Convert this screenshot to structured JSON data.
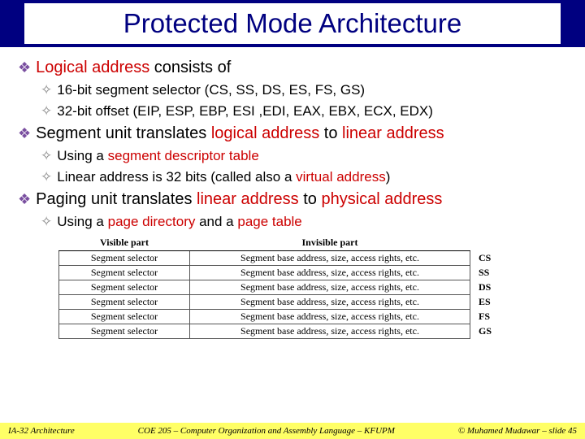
{
  "title": "Protected Mode Architecture",
  "bullets": {
    "b1_pre": "Logical address",
    "b1_post": " consists of",
    "b1a": "16-bit segment selector (CS, SS, DS, ES, FS, GS)",
    "b1b": "32-bit offset (EIP, ESP, EBP, ESI ,EDI, EAX, EBX, ECX, EDX)",
    "b2_pre": "Segment unit translates ",
    "b2_mid1": "logical address",
    "b2_mid2": " to ",
    "b2_end": "linear address",
    "b2a_pre": "Using a ",
    "b2a_red": "segment descriptor table",
    "b2b_pre": "Linear address is 32 bits (called also a ",
    "b2b_red": "virtual address",
    "b2b_post": ")",
    "b3_pre": "Paging unit translates ",
    "b3_mid1": "linear address",
    "b3_mid2": " to ",
    "b3_end": "physical address",
    "b3a_pre": "Using a ",
    "b3a_r1": "page directory",
    "b3a_mid": " and a ",
    "b3a_r2": "page table"
  },
  "table": {
    "h1": "Visible part",
    "h2": "Invisible part",
    "left": "Segment selector",
    "right": "Segment base address, size, access rights, etc.",
    "regs": [
      "CS",
      "SS",
      "DS",
      "ES",
      "FS",
      "GS"
    ]
  },
  "footer": {
    "left": "IA-32 Architecture",
    "center": "COE 205 – Computer Organization and Assembly Language – KFUPM",
    "right": "© Muhamed Mudawar – slide 45"
  }
}
